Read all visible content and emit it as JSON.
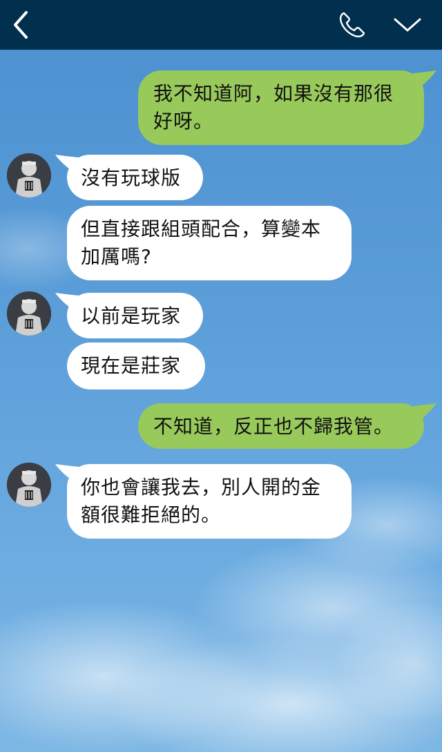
{
  "header": {
    "back_icon": "chevron-left-icon",
    "call_icon": "phone-icon",
    "menu_icon": "chevron-down-icon"
  },
  "colors": {
    "header_bg": "#012f4e",
    "outgoing_bubble": "#98c95b",
    "incoming_bubble": "#ffffff",
    "background_sky": "#5a9dd8"
  },
  "messages": [
    {
      "direction": "out",
      "text": "我不知道阿，如果沒有那很好呀。"
    },
    {
      "direction": "in",
      "text": "沒有玩球版"
    },
    {
      "direction": "in",
      "text": "但直接跟組頭配合，算變本加厲嗎?"
    },
    {
      "direction": "in",
      "text": "以前是玩家"
    },
    {
      "direction": "in",
      "text": "現在是莊家"
    },
    {
      "direction": "out",
      "text": "不知道，反正也不歸我管。"
    },
    {
      "direction": "in",
      "text": "你也會讓我去，別人開的金額很難拒絕的。"
    }
  ]
}
